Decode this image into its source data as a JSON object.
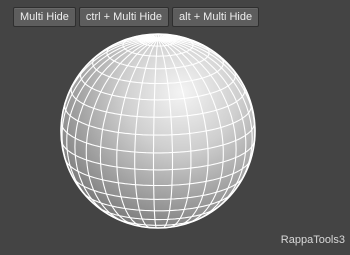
{
  "toolbar": {
    "buttons": [
      {
        "label": "Multi Hide"
      },
      {
        "label": "ctrl + Multi Hide"
      },
      {
        "label": "alt + Multi Hide"
      }
    ]
  },
  "viewport": {
    "object": "sphere-wireframe-icon",
    "background_color": "#444444",
    "wire_color": "#ffffff"
  },
  "watermark": "RappaTools3"
}
